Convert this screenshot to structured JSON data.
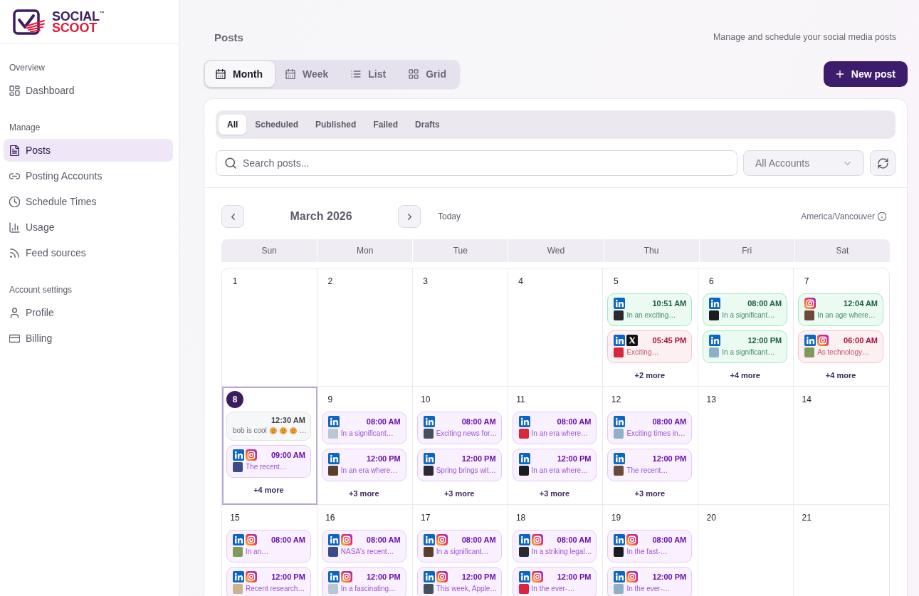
{
  "sidebar": {
    "logo": {
      "line_1": "SOCIAL$^{™}$",
      "line_2": "SCOOT"
    },
    "sections": [
      {
        "label": "Overview",
        "items": [
          {
            "label": "Dashboard",
            "selected": false
          }
        ]
      },
      {
        "label": "Manage",
        "items": [
          {
            "label": "Posts",
            "selected": true
          },
          {
            "label": "Posting Accounts",
            "selected": false
          },
          {
            "label": "Schedule Times",
            "selected": false
          },
          {
            "label": "Usage",
            "selected": false
          },
          {
            "label": "Feed sources",
            "selected": false
          }
        ]
      },
      {
        "label": "Account settings",
        "items": [
          {
            "label": "Profile",
            "selected": false
          },
          {
            "label": "Billing",
            "selected": false
          }
        ]
      }
    ]
  },
  "header": {
    "title": "Posts",
    "subtitle": "Manage and schedule your social media posts"
  },
  "view_tabs": [
    {
      "label": "Month",
      "selected": true
    },
    {
      "label": "Week",
      "selected": false
    },
    {
      "label": "List",
      "selected": false
    },
    {
      "label": "Grid",
      "selected": false
    }
  ],
  "new_post_button": "New post",
  "status_tabs": [
    {
      "label": "All",
      "selected": true
    },
    {
      "label": "Scheduled",
      "selected": false
    },
    {
      "label": "Published",
      "selected": false
    },
    {
      "label": "Failed",
      "selected": false
    },
    {
      "label": "Drafts",
      "selected": false
    }
  ],
  "search": {
    "placeholder": "Search posts..."
  },
  "account_filter": "All Accounts",
  "calendar": {
    "month": "March 2026",
    "today_button": "Today",
    "timezone": "America/Vancouver",
    "weekdays": [
      "Sun",
      "Mon",
      "Tue",
      "Wed",
      "Thu",
      "Fri",
      "Sat"
    ],
    "weeks": [
      [
        {
          "day": "1",
          "today": false
        },
        {
          "day": "2",
          "today": false
        },
        {
          "day": "3",
          "today": false
        },
        {
          "day": "4",
          "today": false
        },
        {
          "day": "5",
          "today": false,
          "posts": [
            {
              "kind": "published",
              "platforms": [
                {
                  "kind": "linkedin"
                }
              ],
              "time": "10:51 AM",
              "thumbnail": true,
              "excerpt": "In an exciting…"
            },
            {
              "kind": "failed",
              "platforms": [
                {
                  "kind": "linkedin"
                },
                {
                  "kind": "x"
                }
              ],
              "time": "05:45 PM",
              "thumbnail": true,
              "excerpt": "Exciting…"
            }
          ],
          "more": "+2 more"
        },
        {
          "day": "6",
          "today": false,
          "posts": [
            {
              "kind": "published",
              "platforms": [
                {
                  "kind": "linkedin"
                }
              ],
              "time": "08:00 AM",
              "thumbnail": true,
              "excerpt": "In a significant…"
            },
            {
              "kind": "published",
              "platforms": [
                {
                  "kind": "linkedin"
                }
              ],
              "time": "12:00 PM",
              "thumbnail": true,
              "excerpt": "In a significant…"
            }
          ],
          "more": "+4 more"
        },
        {
          "day": "7",
          "today": false,
          "posts": [
            {
              "kind": "published",
              "platforms": [
                {
                  "kind": "instagram"
                }
              ],
              "time": "12:04 AM",
              "thumbnail": true,
              "excerpt": "In an age where…"
            },
            {
              "kind": "failed",
              "platforms": [
                {
                  "kind": "linkedin"
                },
                {
                  "kind": "instagram"
                }
              ],
              "time": "06:00 AM",
              "thumbnail": true,
              "excerpt": "As technology…"
            }
          ],
          "more": "+4 more"
        }
      ],
      [
        {
          "day": "8",
          "today": true,
          "posts": [
            {
              "kind": "draft",
              "time": "12:30 AM",
              "thumbnail": false,
              "excerpt": "bob is cool",
              "emojis": [
                {
                  "kind": "face"
                },
                {
                  "kind": "face"
                },
                {
                  "kind": "face"
                }
              ],
              "excerpt_end": "…"
            },
            {
              "kind": "scheduled",
              "platforms": [
                {
                  "kind": "linkedin"
                },
                {
                  "kind": "instagram"
                }
              ],
              "time": "09:00 AM",
              "thumbnail": true,
              "excerpt": "The recent…"
            }
          ],
          "more": "+4 more"
        },
        {
          "day": "9",
          "today": false,
          "posts": [
            {
              "kind": "scheduled",
              "platforms": [
                {
                  "kind": "linkedin"
                }
              ],
              "time": "08:00 AM",
              "thumbnail": true,
              "excerpt": "In a significant…"
            },
            {
              "kind": "scheduled",
              "platforms": [
                {
                  "kind": "linkedin"
                }
              ],
              "time": "12:00 PM",
              "thumbnail": true,
              "excerpt": "In an era where…"
            }
          ],
          "more": "+3 more"
        },
        {
          "day": "10",
          "today": false,
          "posts": [
            {
              "kind": "scheduled",
              "platforms": [
                {
                  "kind": "linkedin"
                }
              ],
              "time": "08:00 AM",
              "thumbnail": true,
              "excerpt": "Exciting news for…"
            },
            {
              "kind": "scheduled",
              "platforms": [
                {
                  "kind": "linkedin"
                }
              ],
              "time": "12:00 PM",
              "thumbnail": true,
              "excerpt": "Spring brings wit…"
            }
          ],
          "more": "+3 more"
        },
        {
          "day": "11",
          "today": false,
          "posts": [
            {
              "kind": "scheduled",
              "platforms": [
                {
                  "kind": "linkedin"
                }
              ],
              "time": "08:00 AM",
              "thumbnail": true,
              "excerpt": "In an era where…"
            },
            {
              "kind": "scheduled",
              "platforms": [
                {
                  "kind": "linkedin"
                }
              ],
              "time": "12:00 PM",
              "thumbnail": true,
              "excerpt": "In an era where…"
            }
          ],
          "more": "+3 more"
        },
        {
          "day": "12",
          "today": false,
          "posts": [
            {
              "kind": "scheduled",
              "platforms": [
                {
                  "kind": "linkedin"
                }
              ],
              "time": "08:00 AM",
              "thumbnail": true,
              "excerpt": "Exciting times in…"
            },
            {
              "kind": "scheduled",
              "platforms": [
                {
                  "kind": "linkedin"
                }
              ],
              "time": "12:00 PM",
              "thumbnail": true,
              "excerpt": "The recent…"
            }
          ],
          "more": "+3 more"
        },
        {
          "day": "13",
          "today": false
        },
        {
          "day": "14",
          "today": false
        }
      ],
      [
        {
          "day": "15",
          "today": false,
          "posts": [
            {
              "kind": "scheduled",
              "platforms": [
                {
                  "kind": "linkedin"
                },
                {
                  "kind": "instagram"
                }
              ],
              "time": "08:00 AM",
              "thumbnail": true,
              "excerpt": "In an…"
            },
            {
              "kind": "scheduled",
              "platforms": [
                {
                  "kind": "linkedin"
                },
                {
                  "kind": "instagram"
                }
              ],
              "time": "12:00 PM",
              "thumbnail": true,
              "excerpt": "Recent research…"
            }
          ]
        },
        {
          "day": "16",
          "today": false,
          "posts": [
            {
              "kind": "scheduled",
              "platforms": [
                {
                  "kind": "linkedin"
                },
                {
                  "kind": "instagram"
                }
              ],
              "time": "08:00 AM",
              "thumbnail": true,
              "excerpt": "NASA's recent…"
            },
            {
              "kind": "scheduled",
              "platforms": [
                {
                  "kind": "linkedin"
                },
                {
                  "kind": "instagram"
                }
              ],
              "time": "12:00 PM",
              "thumbnail": true,
              "excerpt": "In a fascinating…"
            }
          ]
        },
        {
          "day": "17",
          "today": false,
          "posts": [
            {
              "kind": "scheduled",
              "platforms": [
                {
                  "kind": "linkedin"
                },
                {
                  "kind": "instagram"
                }
              ],
              "time": "08:00 AM",
              "thumbnail": true,
              "excerpt": "In a significant…"
            },
            {
              "kind": "scheduled",
              "platforms": [
                {
                  "kind": "linkedin"
                },
                {
                  "kind": "instagram"
                }
              ],
              "time": "12:00 PM",
              "thumbnail": true,
              "excerpt": "This week, Apple…"
            }
          ]
        },
        {
          "day": "18",
          "today": false,
          "posts": [
            {
              "kind": "scheduled",
              "platforms": [
                {
                  "kind": "linkedin"
                },
                {
                  "kind": "instagram"
                }
              ],
              "time": "08:00 AM",
              "thumbnail": true,
              "excerpt": "In a striking legal…"
            },
            {
              "kind": "scheduled",
              "platforms": [
                {
                  "kind": "linkedin"
                },
                {
                  "kind": "instagram"
                }
              ],
              "time": "12:00 PM",
              "thumbnail": true,
              "excerpt": "In the ever-…"
            }
          ]
        },
        {
          "day": "19",
          "today": false,
          "posts": [
            {
              "kind": "scheduled",
              "platforms": [
                {
                  "kind": "linkedin"
                },
                {
                  "kind": "instagram"
                }
              ],
              "time": "08:00 AM",
              "thumbnail": true,
              "excerpt": "In the fast-…"
            },
            {
              "kind": "scheduled",
              "platforms": [
                {
                  "kind": "linkedin"
                },
                {
                  "kind": "instagram"
                }
              ],
              "time": "12:00 PM",
              "thumbnail": true,
              "excerpt": "In the ever-…"
            }
          ]
        },
        {
          "day": "20",
          "today": false
        },
        {
          "day": "21",
          "today": false
        }
      ]
    ]
  }
}
